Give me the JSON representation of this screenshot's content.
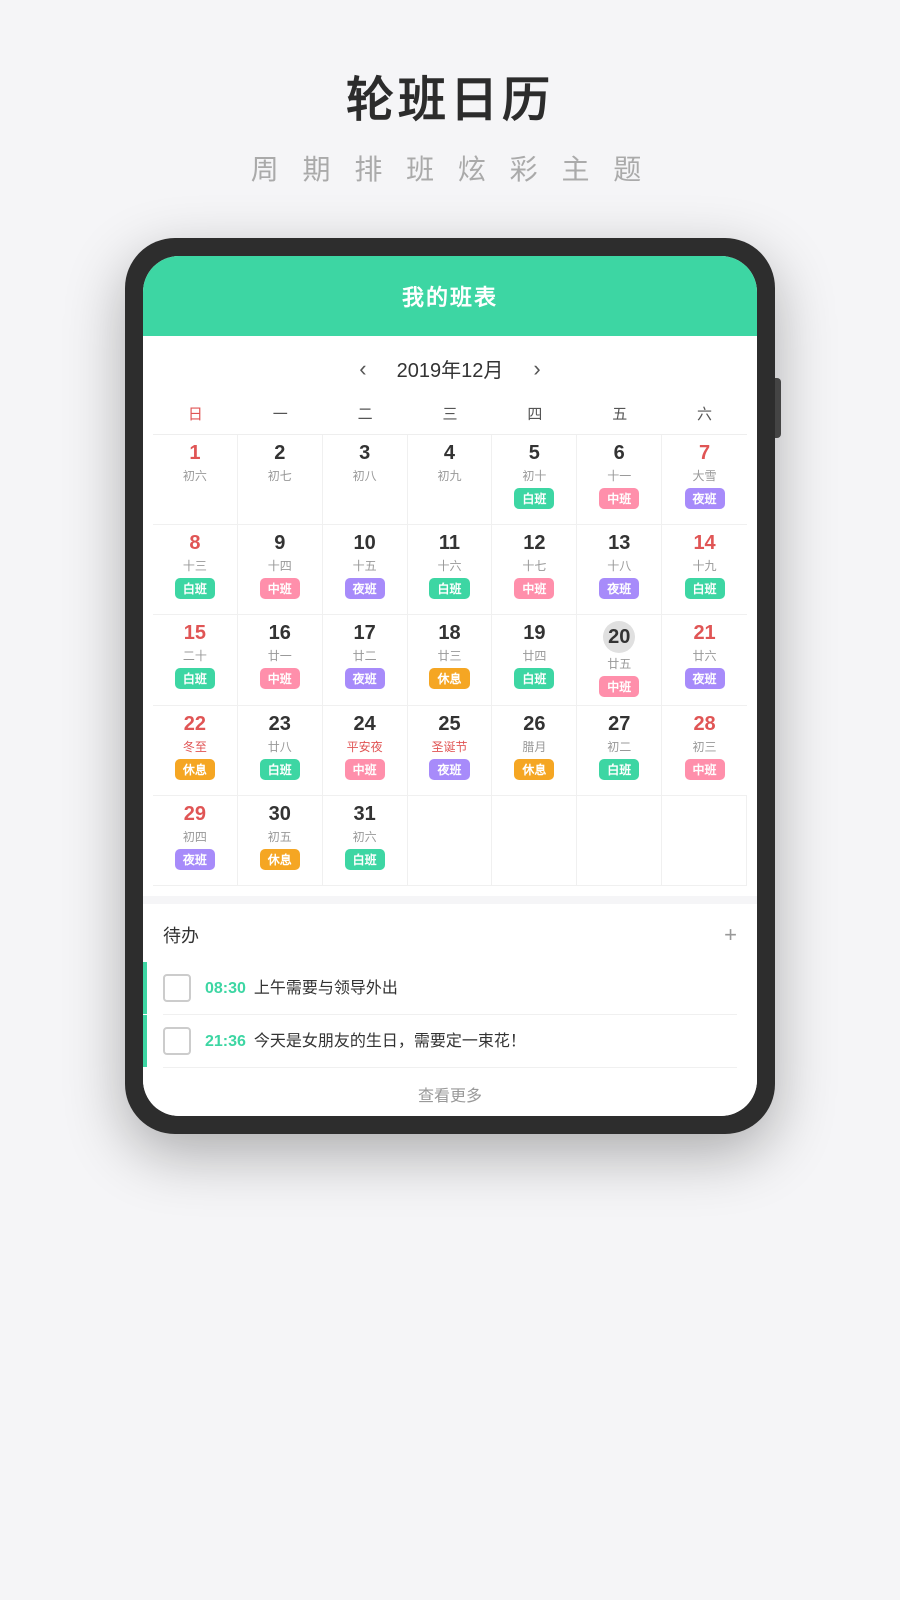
{
  "header": {
    "title": "轮班日历",
    "subtitle": "周 期 排 班   炫 彩 主 题"
  },
  "phone": {
    "app_title": "我的班表",
    "month_nav": {
      "prev": "‹",
      "next": "›",
      "title": "2019年12月"
    },
    "weekdays": [
      "日",
      "一",
      "二",
      "三",
      "四",
      "五",
      "六"
    ],
    "calendar": [
      {
        "day": "1",
        "lunar": "初六",
        "shift": "",
        "shiftType": "",
        "red": true,
        "empty": false
      },
      {
        "day": "2",
        "lunar": "初七",
        "shift": "",
        "shiftType": "",
        "red": false,
        "empty": false
      },
      {
        "day": "3",
        "lunar": "初八",
        "shift": "",
        "shiftType": "",
        "red": false,
        "empty": false
      },
      {
        "day": "4",
        "lunar": "初九",
        "shift": "",
        "shiftType": "",
        "red": false,
        "empty": false
      },
      {
        "day": "5",
        "lunar": "初十",
        "shift": "白班",
        "shiftType": "bai",
        "red": false,
        "empty": false
      },
      {
        "day": "6",
        "lunar": "十一",
        "shift": "中班",
        "shiftType": "zhong",
        "red": false,
        "empty": false
      },
      {
        "day": "7",
        "lunar": "大雪",
        "shift": "夜班",
        "shiftType": "ye",
        "red": true,
        "empty": false
      },
      {
        "day": "8",
        "lunar": "十三",
        "shift": "白班",
        "shiftType": "bai",
        "red": true,
        "empty": false
      },
      {
        "day": "9",
        "lunar": "十四",
        "shift": "中班",
        "shiftType": "zhong",
        "red": false,
        "empty": false
      },
      {
        "day": "10",
        "lunar": "十五",
        "shift": "夜班",
        "shiftType": "ye",
        "red": false,
        "empty": false
      },
      {
        "day": "11",
        "lunar": "十六",
        "shift": "白班",
        "shiftType": "bai",
        "red": false,
        "empty": false
      },
      {
        "day": "12",
        "lunar": "十七",
        "shift": "中班",
        "shiftType": "zhong",
        "red": false,
        "empty": false
      },
      {
        "day": "13",
        "lunar": "十八",
        "shift": "夜班",
        "shiftType": "ye",
        "red": false,
        "empty": false
      },
      {
        "day": "14",
        "lunar": "十九",
        "shift": "白班",
        "shiftType": "bai",
        "red": true,
        "empty": false
      },
      {
        "day": "15",
        "lunar": "二十",
        "shift": "白班",
        "shiftType": "bai",
        "red": true,
        "empty": false
      },
      {
        "day": "16",
        "lunar": "廿一",
        "shift": "中班",
        "shiftType": "zhong",
        "red": false,
        "empty": false
      },
      {
        "day": "17",
        "lunar": "廿二",
        "shift": "夜班",
        "shiftType": "ye",
        "red": false,
        "empty": false
      },
      {
        "day": "18",
        "lunar": "廿三",
        "shift": "休息",
        "shiftType": "xiu",
        "red": false,
        "empty": false
      },
      {
        "day": "19",
        "lunar": "廿四",
        "shift": "白班",
        "shiftType": "bai",
        "red": false,
        "empty": false
      },
      {
        "day": "20",
        "lunar": "廿五",
        "shift": "中班",
        "shiftType": "zhong",
        "red": false,
        "empty": false,
        "highlight": true
      },
      {
        "day": "21",
        "lunar": "廿六",
        "shift": "夜班",
        "shiftType": "ye",
        "red": true,
        "empty": false
      },
      {
        "day": "22",
        "lunar": "冬至",
        "shift": "休息",
        "shiftType": "xiu",
        "red": true,
        "empty": false,
        "lunarSpecial": true
      },
      {
        "day": "23",
        "lunar": "廿八",
        "shift": "白班",
        "shiftType": "bai",
        "red": false,
        "empty": false
      },
      {
        "day": "24",
        "lunar": "平安夜",
        "shift": "中班",
        "shiftType": "zhong",
        "red": false,
        "empty": false,
        "lunarSpecial": true
      },
      {
        "day": "25",
        "lunar": "圣诞节",
        "shift": "夜班",
        "shiftType": "ye",
        "red": false,
        "empty": false,
        "lunarSpecial": true
      },
      {
        "day": "26",
        "lunar": "腊月",
        "shift": "休息",
        "shiftType": "xiu",
        "red": false,
        "empty": false
      },
      {
        "day": "27",
        "lunar": "初二",
        "shift": "白班",
        "shiftType": "bai",
        "red": false,
        "empty": false
      },
      {
        "day": "28",
        "lunar": "初三",
        "shift": "中班",
        "shiftType": "zhong",
        "red": true,
        "empty": false
      },
      {
        "day": "29",
        "lunar": "初四",
        "shift": "夜班",
        "shiftType": "ye",
        "red": true,
        "empty": false
      },
      {
        "day": "30",
        "lunar": "初五",
        "shift": "休息",
        "shiftType": "xiu",
        "red": false,
        "empty": false
      },
      {
        "day": "31",
        "lunar": "初六",
        "shift": "白班",
        "shiftType": "bai",
        "red": false,
        "empty": false
      },
      {
        "day": "",
        "lunar": "",
        "shift": "",
        "shiftType": "",
        "red": false,
        "empty": true
      },
      {
        "day": "",
        "lunar": "",
        "shift": "",
        "shiftType": "",
        "red": false,
        "empty": true
      },
      {
        "day": "",
        "lunar": "",
        "shift": "",
        "shiftType": "",
        "red": false,
        "empty": true
      },
      {
        "day": "",
        "lunar": "",
        "shift": "",
        "shiftType": "",
        "red": false,
        "empty": true
      }
    ],
    "todo": {
      "title": "待办",
      "add_label": "+",
      "items": [
        {
          "time": "08:30",
          "text": "上午需要与领导外出"
        },
        {
          "time": "21:36",
          "text": "今天是女朋友的生日，需要定一束花！"
        }
      ],
      "more_label": "查看更多"
    }
  }
}
